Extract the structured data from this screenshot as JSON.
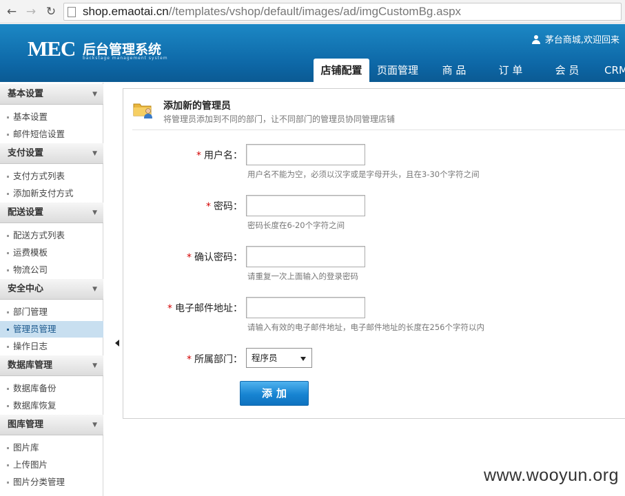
{
  "browser": {
    "url_host": "shop.emaotai.cn",
    "url_path": "//templates/vshop/default/images/ad/imgCustomBg.aspx"
  },
  "header": {
    "logo_mark": "MEC",
    "logo_title": "后台管理系统",
    "logo_subtitle": "backstage management system",
    "welcome": "茅台商城,欢迎回来",
    "tabs": [
      {
        "label": "店铺配置",
        "active": true
      },
      {
        "label": "页面管理"
      },
      {
        "label": "商 品"
      },
      {
        "label": "订 单"
      },
      {
        "label": "会 员"
      },
      {
        "label": "CRM"
      }
    ]
  },
  "sidebar": {
    "groups": [
      {
        "title": "基本设置",
        "items": [
          "基本设置",
          "邮件短信设置"
        ]
      },
      {
        "title": "支付设置",
        "items": [
          "支付方式列表",
          "添加新支付方式"
        ]
      },
      {
        "title": "配送设置",
        "items": [
          "配送方式列表",
          "运费模板",
          "物流公司"
        ]
      },
      {
        "title": "安全中心",
        "items": [
          "部门管理",
          "管理员管理",
          "操作日志"
        ]
      },
      {
        "title": "数据库管理",
        "items": [
          "数据库备份",
          "数据库恢复"
        ]
      },
      {
        "title": "图库管理",
        "items": [
          "图片库",
          "上传图片",
          "图片分类管理"
        ]
      }
    ],
    "active_item": "管理员管理"
  },
  "panel": {
    "title": "添加新的管理员",
    "description": "将管理员添加到不同的部门，让不同部门的管理员协同管理店铺"
  },
  "form": {
    "required_mark": "*",
    "username_label": "用户名：",
    "username_value": "",
    "username_hint": "用户名不能为空，必须以汉字或是字母开头，且在3-30个字符之间",
    "password_label": "密码：",
    "password_value": "",
    "password_hint": "密码长度在6-20个字符之间",
    "confirm_label": "确认密码：",
    "confirm_value": "",
    "confirm_hint": "请重复一次上面输入的登录密码",
    "email_label": "电子邮件地址：",
    "email_value": "",
    "email_hint": "请输入有效的电子邮件地址，电子邮件地址的长度在256个字符以内",
    "dept_label": "所属部门：",
    "dept_selected": "程序员",
    "submit_label": "添加"
  },
  "watermark": "www.wooyun.org",
  "colors": {
    "header_blue": "#0d67a6",
    "button_blue": "#1784d2",
    "required_red": "#d40000",
    "active_item_bg": "#c8dff0"
  }
}
